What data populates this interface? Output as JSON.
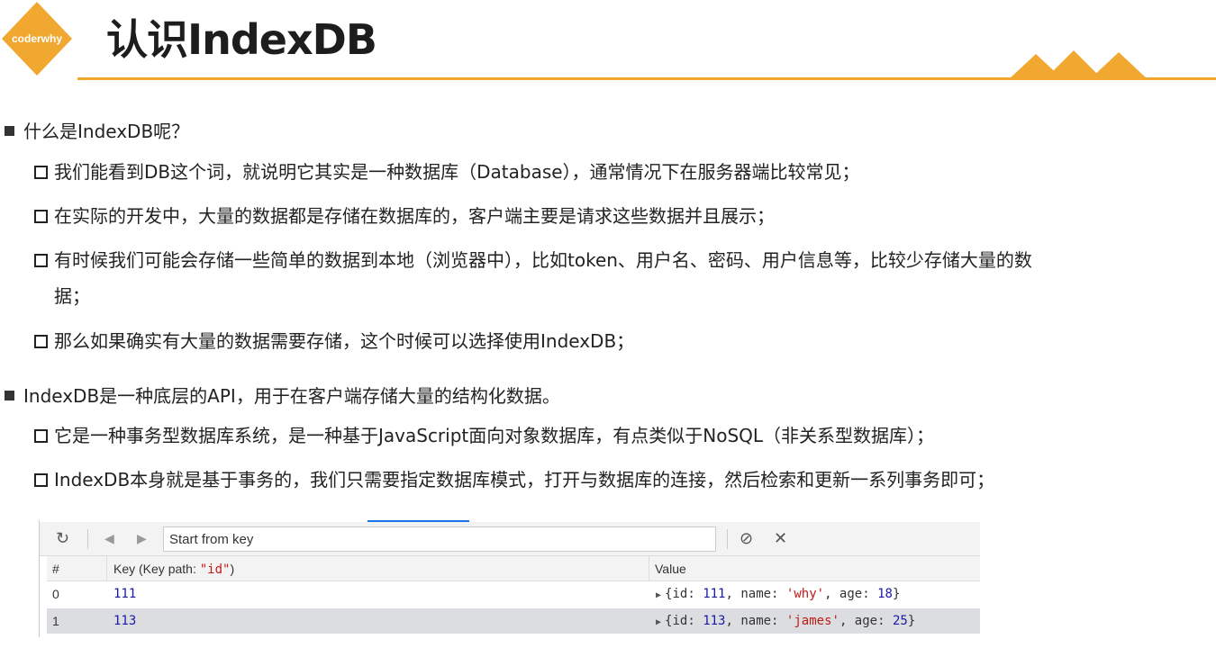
{
  "header": {
    "logo_text": "coderwhy",
    "title": "认识IndexDB"
  },
  "colors": {
    "accent": "#f1a830",
    "logo": "#f1a830"
  },
  "content": {
    "sections": [
      {
        "heading": "什么是IndexDB呢？",
        "items": [
          "我们能看到DB这个词，就说明它其实是一种数据库（Database），通常情况下在服务器端比较常见；",
          "在实际的开发中，大量的数据都是存储在数据库的，客户端主要是请求这些数据并且展示；",
          "有时候我们可能会存储一些简单的数据到本地（浏览器中），比如token、用户名、密码、用户信息等，比较少存储大量的数",
          "据；",
          "那么如果确实有大量的数据需要存储，这个时候可以选择使用IndexDB；"
        ]
      },
      {
        "heading": "IndexDB是一种底层的API，用于在客户端存储大量的结构化数据。",
        "items": [
          "它是一种事务型数据库系统，是一种基于JavaScript面向对象数据库，有点类似于NoSQL（非关系型数据库）；",
          "IndexDB本身就是基于事务的，我们只需要指定数据库模式，打开与数据库的连接，然后检索和更新一系列事务即可；"
        ]
      }
    ]
  },
  "devtools": {
    "refresh_icon": "refresh-icon",
    "prev_icon": "triangle-left-icon",
    "next_icon": "triangle-right-icon",
    "key_placeholder": "Start from key",
    "clear_icon": "clear-icon",
    "delete_icon": "close-icon",
    "columns": {
      "index": "#",
      "key_prefix": "Key (Key path: ",
      "key_path": "\"id\"",
      "key_suffix": ")",
      "value": "Value"
    },
    "rows": [
      {
        "index": "0",
        "key": "111",
        "v_open": "{id: ",
        "v_id": "111",
        "v_mid1": ", name: ",
        "v_name": "'why'",
        "v_mid2": ", age: ",
        "v_age": "18",
        "v_close": "}"
      },
      {
        "index": "1",
        "key": "113",
        "v_open": "{id: ",
        "v_id": "113",
        "v_mid1": ", name: ",
        "v_name": "'james'",
        "v_mid2": ", age: ",
        "v_age": "25",
        "v_close": "}"
      }
    ]
  }
}
